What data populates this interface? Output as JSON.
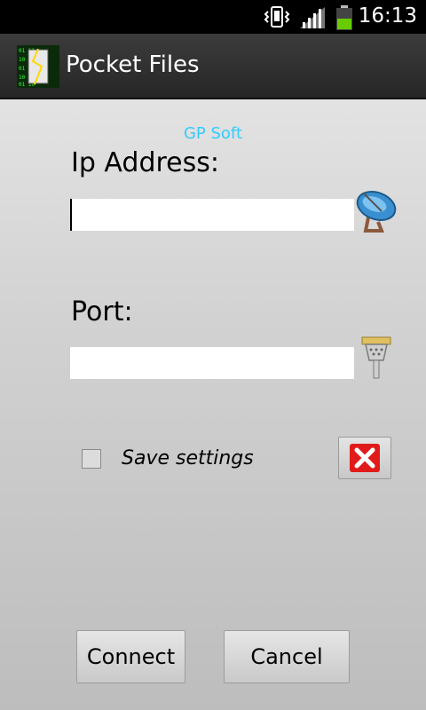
{
  "status_bar": {
    "time": "16:13",
    "icons": [
      "vibrate-icon",
      "signal-icon",
      "battery-icon"
    ],
    "battery_color": "#66cc00"
  },
  "action_bar": {
    "title": "Pocket Files",
    "icon": "app-icon"
  },
  "brand": "GP Soft",
  "ip": {
    "label": "Ip Address:",
    "value": "",
    "placeholder": "",
    "icon": "satellite-dish-icon"
  },
  "port": {
    "label": "Port:",
    "value": "",
    "placeholder": "",
    "icon": "serial-connector-icon"
  },
  "save_settings": {
    "label": "Save settings",
    "checked": false
  },
  "clear_button": {
    "icon": "red-x-icon"
  },
  "buttons": {
    "connect": "Connect",
    "cancel": "Cancel"
  },
  "colors": {
    "brand": "#33ccff",
    "action_bar": "#2e2e2e",
    "status_bar": "#000000"
  }
}
